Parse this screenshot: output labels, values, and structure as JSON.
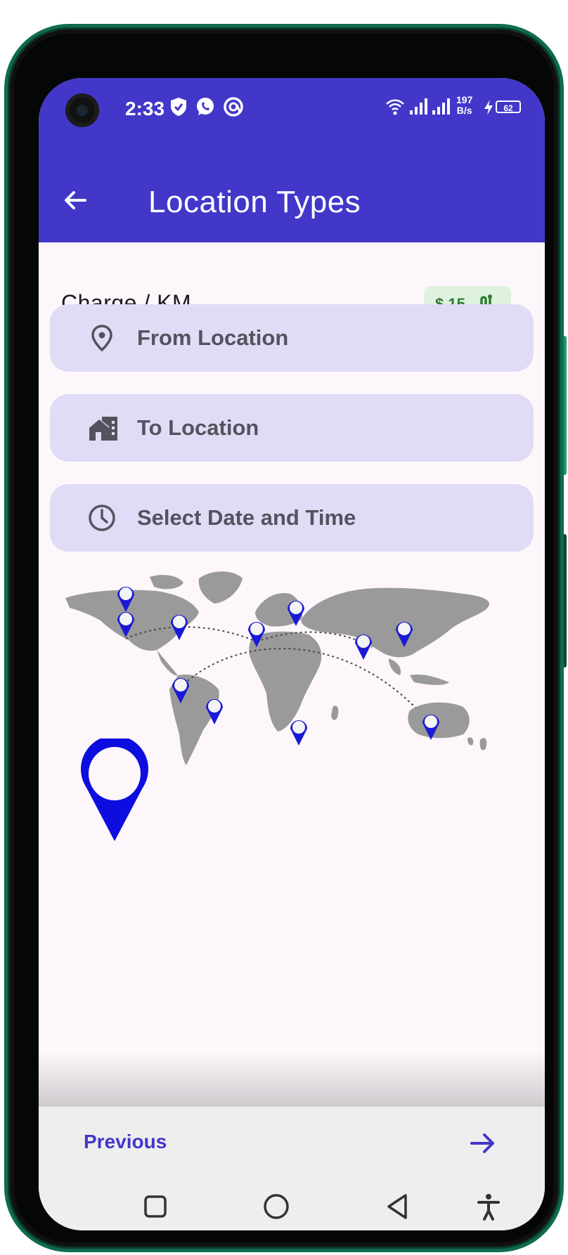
{
  "status_bar": {
    "time": "2:33",
    "net_speed_value": "197",
    "net_speed_unit": "B/s",
    "battery": "62",
    "icons": [
      "shield-icon",
      "whatsapp-icon",
      "at-icon",
      "wifi-icon",
      "signal-icon",
      "signal-icon",
      "charging-icon",
      "battery-icon"
    ]
  },
  "app_bar": {
    "title": "Location Types",
    "back_icon": "arrow-back-icon"
  },
  "charge": {
    "label": "Charge / KM",
    "chip_text": "$ 15",
    "chip_icon": "route-icon"
  },
  "fields": {
    "from": {
      "label": "From Location",
      "icon": "location-pin-icon"
    },
    "to": {
      "label": "To Location",
      "icon": "home-work-icon"
    },
    "datetime": {
      "label": "Select Date and Time",
      "icon": "clock-icon"
    }
  },
  "illustration": {
    "name": "world-map-with-location-pins",
    "big_pin": "location-pin-icon"
  },
  "bottom_bar": {
    "previous_label": "Previous",
    "next_icon": "arrow-forward-icon"
  },
  "nav_bar": {
    "icons": [
      "square-recents-icon",
      "circle-home-icon",
      "triangle-back-icon",
      "accessibility-icon"
    ]
  },
  "colors": {
    "primary": "#4337c9",
    "field_background": "#e0dcf5",
    "chip_background": "#dff2de",
    "chip_text": "#2f7d32",
    "surface": "#fdf7fc",
    "bottom_bar": "#eeeeee"
  }
}
